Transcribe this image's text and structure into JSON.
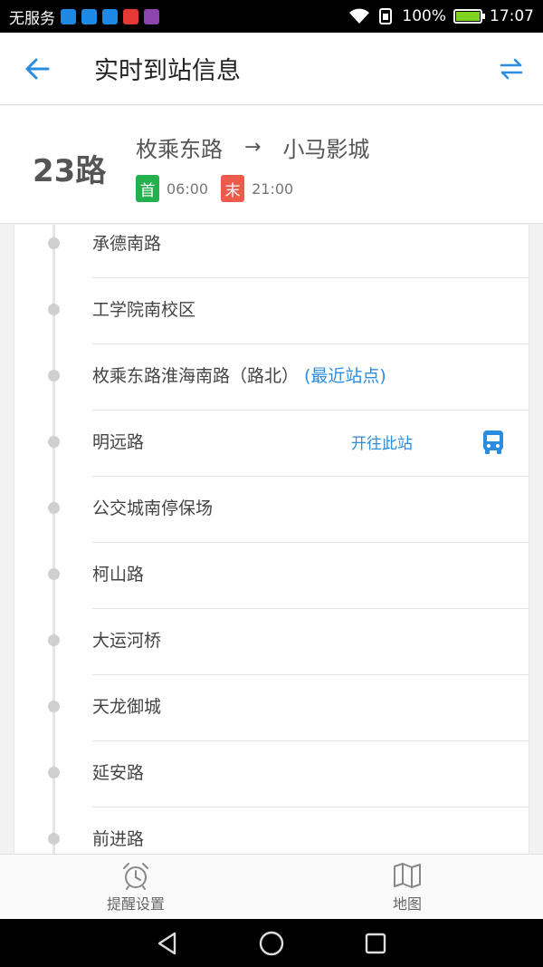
{
  "status_bar": {
    "carrier": "无服务",
    "battery_percent": "100%",
    "time": "17:07"
  },
  "appbar": {
    "title": "实时到站信息",
    "back_icon": "back-arrow-icon",
    "swap_icon": "swap-direction-icon"
  },
  "route": {
    "number": "23路",
    "from": "枚乘东路",
    "arrow": "→",
    "to": "小马影城",
    "first_label": "首",
    "first_time": "06:00",
    "last_label": "末",
    "last_time": "21:00"
  },
  "stops": [
    {
      "name": "承德南路",
      "suffix": ""
    },
    {
      "name": "工学院南校区",
      "suffix": ""
    },
    {
      "name": "枚乘东路淮海南路（路北）",
      "suffix": "(最近站点)"
    },
    {
      "name": "明远路",
      "suffix": ""
    },
    {
      "name": "公交城南停保场",
      "suffix": ""
    },
    {
      "name": "柯山路",
      "suffix": ""
    },
    {
      "name": "大运河桥",
      "suffix": ""
    },
    {
      "name": "天龙御城",
      "suffix": ""
    },
    {
      "name": "延安路",
      "suffix": ""
    },
    {
      "name": "前进路",
      "suffix": ""
    }
  ],
  "bus_status": {
    "heading_label": "开往此站",
    "icon": "bus-icon"
  },
  "bottom_tabs": [
    {
      "label": "提醒设置",
      "icon": "alarm-clock-icon"
    },
    {
      "label": "地图",
      "icon": "map-icon"
    }
  ],
  "colors": {
    "accent": "#2b8de0",
    "first_badge": "#22b14c",
    "last_badge": "#ee5a4b"
  }
}
